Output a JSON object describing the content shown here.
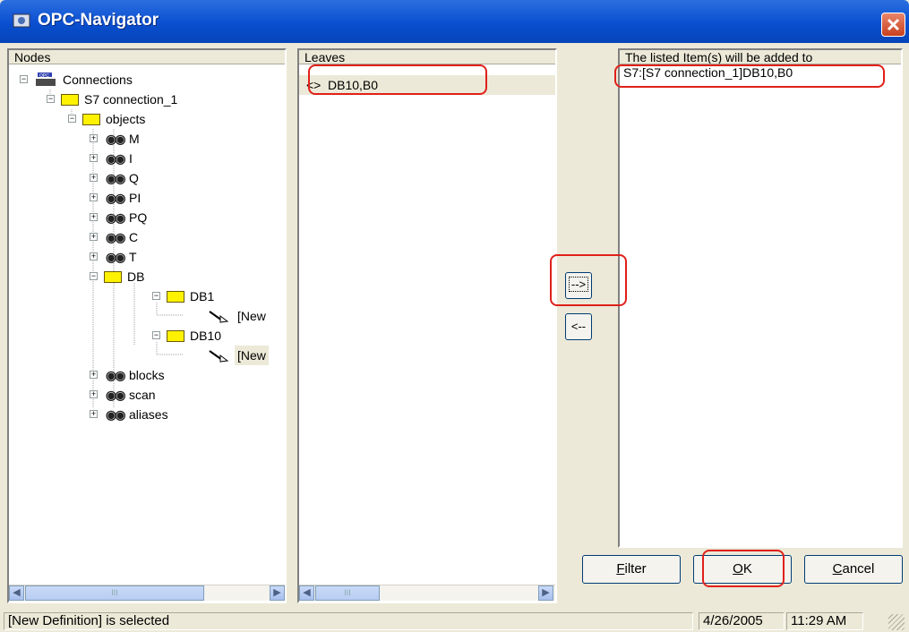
{
  "window": {
    "title": "OPC-Navigator",
    "icon": "opc-navigator-icon",
    "close_icon": "close-icon"
  },
  "nodes_panel": {
    "header": "Nodes",
    "tree": [
      {
        "label": "Connections",
        "icon": "network-icon",
        "expander": "−"
      },
      {
        "label": "S7 connection_1",
        "icon": "folder-icon",
        "expander": "−"
      },
      {
        "label": "objects",
        "icon": "folder-icon",
        "expander": "−"
      },
      {
        "label": "M",
        "icon": "binoculars-icon",
        "expander": "+"
      },
      {
        "label": "I",
        "icon": "binoculars-icon",
        "expander": "+"
      },
      {
        "label": "Q",
        "icon": "binoculars-icon",
        "expander": "+"
      },
      {
        "label": "PI",
        "icon": "binoculars-icon",
        "expander": "+"
      },
      {
        "label": "PQ",
        "icon": "binoculars-icon",
        "expander": "+"
      },
      {
        "label": "C",
        "icon": "binoculars-icon",
        "expander": "+"
      },
      {
        "label": "T",
        "icon": "binoculars-icon",
        "expander": "+"
      },
      {
        "label": "DB",
        "icon": "folder-icon",
        "expander": "−"
      },
      {
        "label": "DB1",
        "icon": "folder-icon",
        "expander": "−"
      },
      {
        "label": "[New",
        "icon": "wand-icon",
        "expander": ""
      },
      {
        "label": "DB10",
        "icon": "folder-icon",
        "expander": "−"
      },
      {
        "label": "[New",
        "icon": "wand-icon",
        "expander": ""
      },
      {
        "label": "blocks",
        "icon": "binoculars-icon",
        "expander": "+"
      },
      {
        "label": "scan",
        "icon": "binoculars-icon",
        "expander": "+"
      },
      {
        "label": "aliases",
        "icon": "binoculars-icon",
        "expander": "+"
      }
    ],
    "scroll_thumb_glyph": "III"
  },
  "leaves_panel": {
    "header": "Leaves",
    "items": [
      {
        "label": "DB10,B0",
        "icon": "<>"
      }
    ],
    "scroll_thumb_glyph": "III"
  },
  "buttons": {
    "add": "-->",
    "remove": "<--",
    "filter_access": "F",
    "filter_rest": "ilter",
    "ok_access": "O",
    "ok_rest": "K",
    "cancel_access": "C",
    "cancel_rest": "ancel"
  },
  "target_panel": {
    "header": "The listed Item(s) will be added to",
    "items": [
      "S7:[S7 connection_1]DB10,B0"
    ]
  },
  "status_bar": {
    "message": "[New Definition] is selected",
    "date": "4/26/2005",
    "time": "11:29 AM"
  },
  "colors": {
    "highlight": "#E0201A",
    "folder": "#FFF200",
    "titlebar": "#0A4FD0"
  }
}
